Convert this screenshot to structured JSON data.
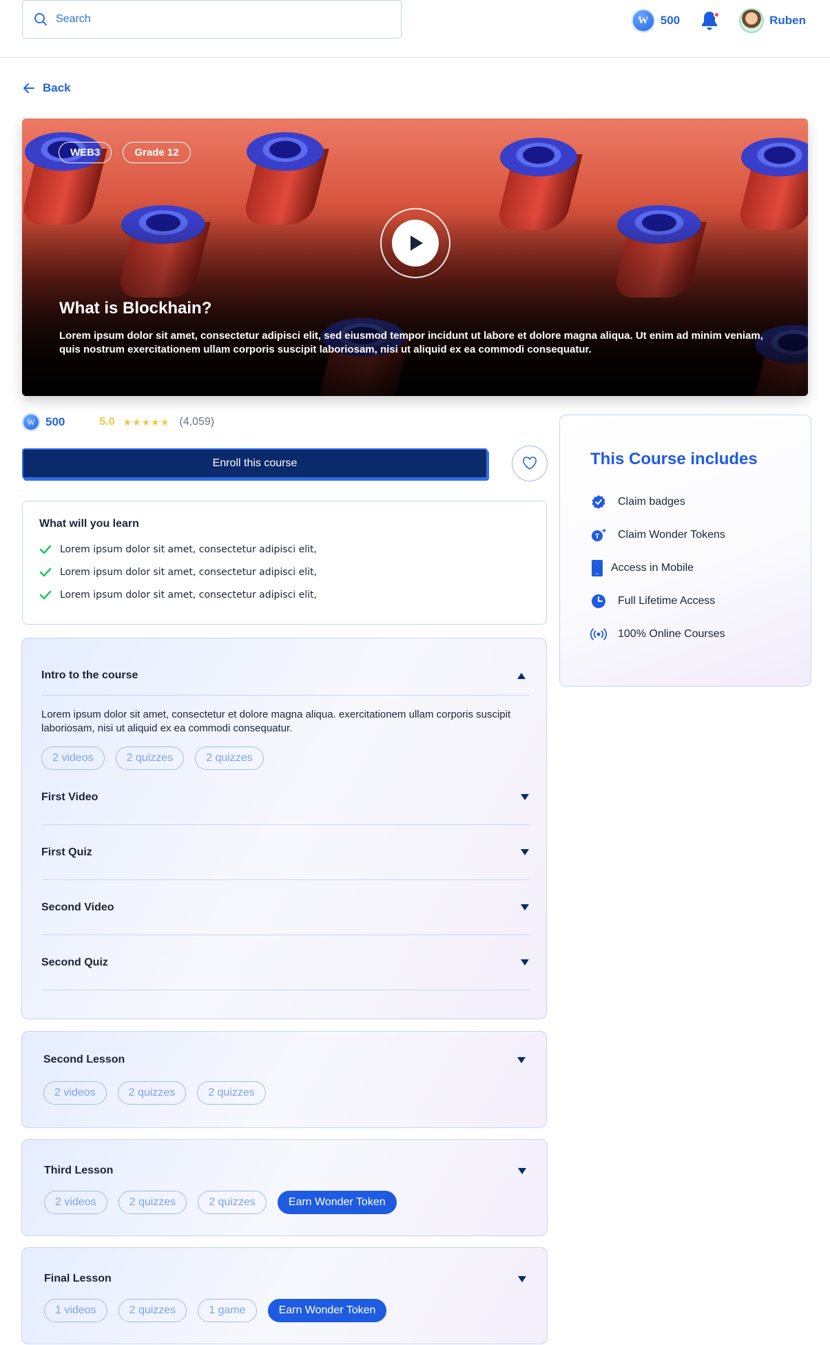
{
  "header": {
    "search_placeholder": "Search",
    "balance": "500",
    "user_name": "Ruben"
  },
  "back_label": "Back",
  "hero": {
    "tags": [
      "WEB3",
      "Grade 12"
    ],
    "title": "What is Blockhain?",
    "description": "Lorem ipsum dolor sit amet, consectetur adipisci elit, sed eiusmod tempor incidunt ut labore et dolore magna aliqua. Ut enim ad minim veniam, quis nostrum exercitationem ullam corporis suscipit laboriosam, nisi ut aliquid ex ea commodi consequatur."
  },
  "course": {
    "price": "500",
    "rating": "5.0",
    "stars": "★★★★★",
    "reviews": "(4,059)",
    "enroll_label": "Enroll this course"
  },
  "learn": {
    "title": "What will you learn",
    "items": [
      "Lorem ipsum dolor sit amet, consectetur adipisci elit,",
      "Lorem ipsum dolor sit amet, consectetur adipisci elit,",
      "Lorem ipsum dolor sit amet, consectetur adipisci elit,"
    ]
  },
  "intro": {
    "title": "Intro to the course",
    "description": "Lorem ipsum dolor sit amet, consectetur et dolore magna aliqua. exercitationem ullam corporis suscipit laboriosam, nisi ut aliquid ex ea commodi consequatur.",
    "pills": [
      "2 videos",
      "2 quizzes",
      "2 quizzes"
    ],
    "subitems": [
      "First Video",
      "First Quiz",
      "Second Video",
      "Second Quiz"
    ]
  },
  "lessons": [
    {
      "title": "Second Lesson",
      "pills": [
        "2 videos",
        "2 quizzes",
        "2 quizzes"
      ]
    },
    {
      "title": "Third Lesson",
      "pills": [
        "2 videos",
        "2 quizzes",
        "2 quizzes"
      ],
      "cta": "Earn Wonder Token"
    },
    {
      "title": "Final Lesson",
      "pills": [
        "1 videos",
        "2 quizzes",
        "1 game"
      ],
      "cta": "Earn Wonder Token"
    }
  ],
  "includes": {
    "title": "This Course includes",
    "items": [
      {
        "label": "Claim badges",
        "icon": "badge-check-icon"
      },
      {
        "label": "Claim Wonder Tokens",
        "icon": "token-sparkle-icon"
      },
      {
        "label": "Access in Mobile",
        "icon": "mobile-icon"
      },
      {
        "label": "Full Lifetime Access",
        "icon": "clock-icon"
      },
      {
        "label": "100% Online Courses",
        "icon": "broadcast-icon"
      }
    ]
  },
  "colors": {
    "primary": "#1e5be0",
    "enroll_bg": "#0b2a6b",
    "star": "#f5c542",
    "check": "#22c55e"
  }
}
